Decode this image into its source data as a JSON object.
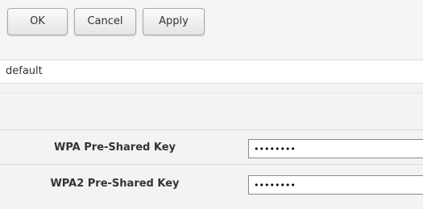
{
  "toolbar": {
    "ok_label": "OK",
    "cancel_label": "Cancel",
    "apply_label": "Apply"
  },
  "profile": {
    "name": "default"
  },
  "fields": {
    "wpa_label": "WPA Pre-Shared Key",
    "wpa_value": "••••••••",
    "wpa2_label": "WPA2 Pre-Shared Key",
    "wpa2_value": "••••••••"
  }
}
